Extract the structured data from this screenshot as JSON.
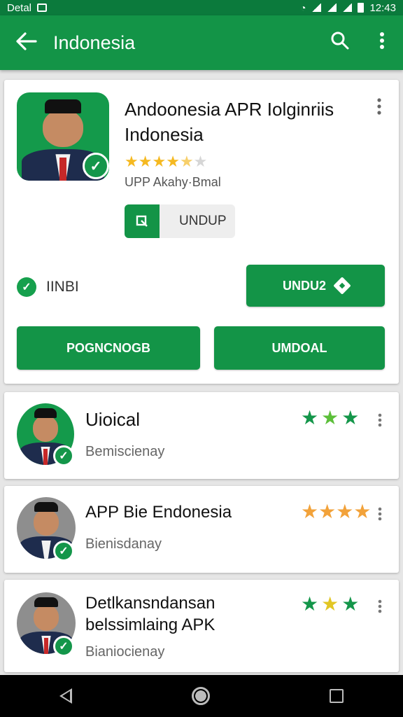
{
  "statusbar": {
    "carrier": "Detal",
    "time": "12:43"
  },
  "appbar": {
    "back_icon": "arrow-left-icon",
    "title": "Indonesia",
    "search_icon": "search-icon",
    "more_icon": "more-vert-icon"
  },
  "colors": {
    "primary": "#139447",
    "statusbar": "#0b7a3c",
    "star_gold": "#f5b921",
    "star_green": "#14964a"
  },
  "featured": {
    "name": "Andoonesia APR Iolginriis Indonesia",
    "rating": 4.5,
    "rating_max": 5,
    "meta": "UPP Akahy·Bmal",
    "chip_label": "UNDUP",
    "verified_label": "IINBI",
    "install_button": "UNDU2",
    "left_button": "POGNCNOGB",
    "right_button": "UMDOAL"
  },
  "list": [
    {
      "title": "Uioical",
      "subtitle": "Bemiscienay",
      "stars": [
        "green",
        "lightgreen",
        "green"
      ]
    },
    {
      "title": "APP Bie Endonesia",
      "subtitle": "Bienisdanay",
      "stars": [
        "orange",
        "orange",
        "orange",
        "orange"
      ]
    },
    {
      "title": "Detlkansndansan\nbelssimlaing APK",
      "subtitle": "Bianiocienay",
      "stars": [
        "green",
        "yellow",
        "green"
      ]
    }
  ]
}
